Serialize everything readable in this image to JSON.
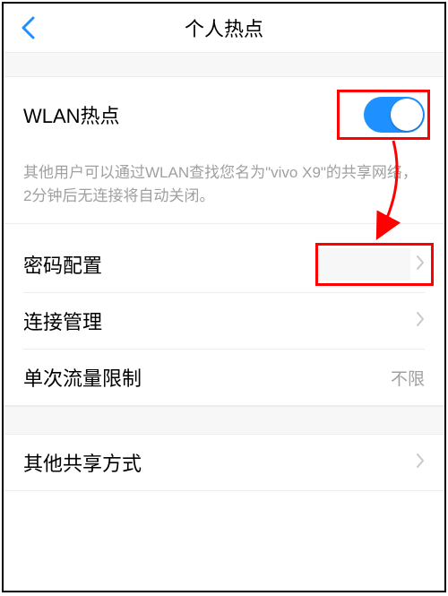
{
  "header": {
    "title": "个人热点"
  },
  "hotspot": {
    "label": "WLAN热点",
    "help": "其他用户可以通过WLAN查找您名为\"vivo X9\"的共享网络，2分钟后无连接将自动关闭。"
  },
  "rows": {
    "password": {
      "label": "密码配置"
    },
    "conn_mgmt": {
      "label": "连接管理"
    },
    "data_limit": {
      "label": "单次流量限制",
      "value": "不限"
    },
    "other_share": {
      "label": "其他共享方式"
    }
  }
}
